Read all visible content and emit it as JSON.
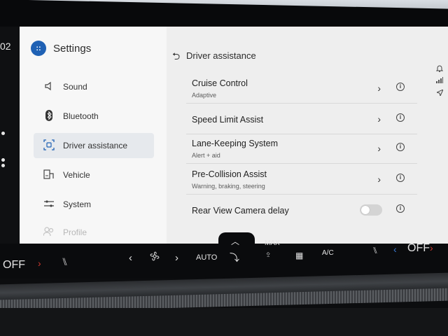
{
  "edge": {
    "partial_text": "02"
  },
  "settings": {
    "app_icon_text": "::",
    "title": "Settings",
    "nav": [
      {
        "label": "Sound",
        "icon": "speaker-icon"
      },
      {
        "label": "Bluetooth",
        "icon": "bluetooth-icon"
      },
      {
        "label": "Driver assistance",
        "icon": "driver-assist-icon",
        "active": true
      },
      {
        "label": "Vehicle",
        "icon": "vehicle-icon"
      },
      {
        "label": "System",
        "icon": "system-icon"
      },
      {
        "label": "Profile",
        "icon": "profile-icon"
      }
    ]
  },
  "panel": {
    "title": "Driver assistance",
    "rows": [
      {
        "label": "Cruise Control",
        "sub": "Adaptive"
      },
      {
        "label": "Speed Limit Assist",
        "sub": ""
      },
      {
        "label": "Lane-Keeping System",
        "sub": "Alert + aid"
      },
      {
        "label": "Pre-Collision Assist",
        "sub": "Warning, braking, steering"
      },
      {
        "label": "Rear View Camera delay",
        "sub": "",
        "toggle": false
      }
    ],
    "info_glyph": "i",
    "chevron_glyph": "›"
  },
  "climate": {
    "left_off": "OFF",
    "auto": "AUTO",
    "max": "MAX",
    "ac": "A/C",
    "right_off": "OFF"
  },
  "colors": {
    "accent": "#1f61b4",
    "red": "#d2392e",
    "blue": "#3a7bd5"
  }
}
